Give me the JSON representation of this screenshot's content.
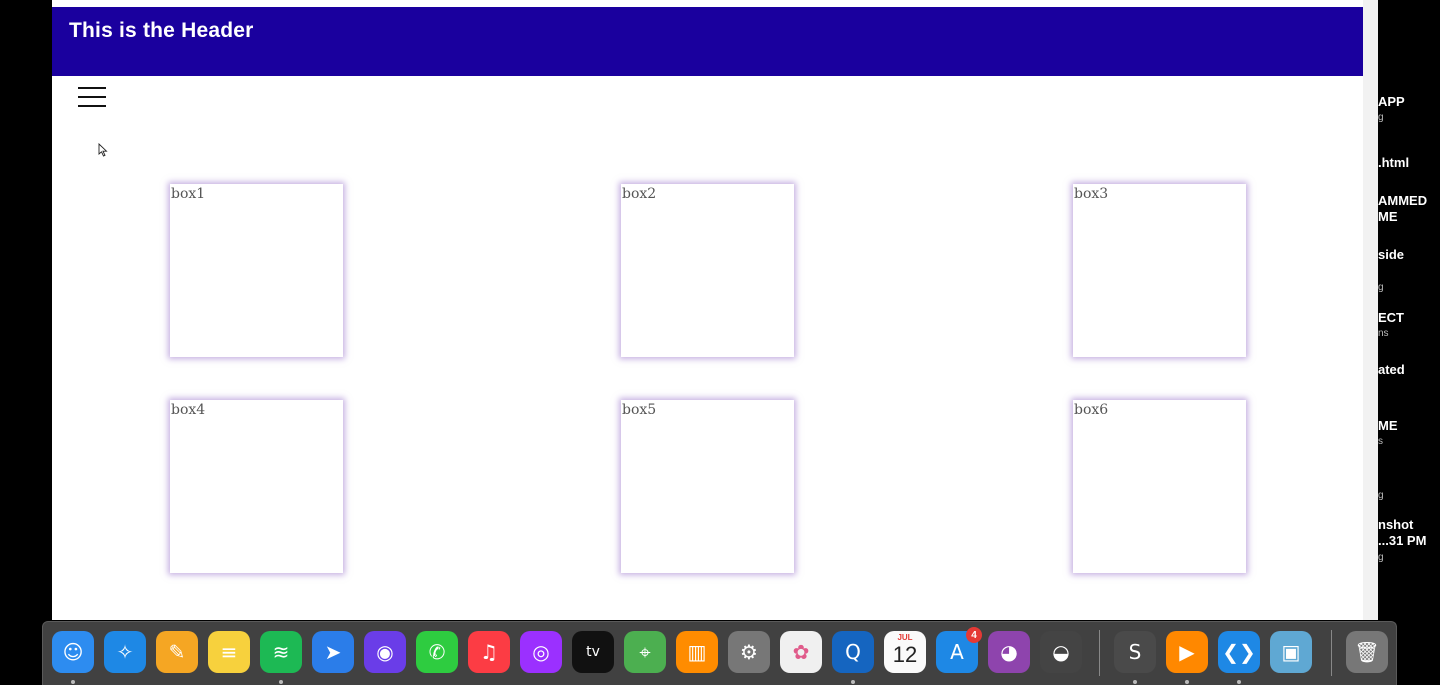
{
  "header": {
    "title": "This is the Header"
  },
  "boxes": [
    {
      "label": "box1"
    },
    {
      "label": "box2"
    },
    {
      "label": "box3"
    },
    {
      "label": "box4"
    },
    {
      "label": "box5"
    },
    {
      "label": "box6"
    }
  ],
  "right_panel": {
    "items": [
      {
        "text": "APP",
        "sub": "g"
      },
      {
        "text": ".html",
        "sub": ""
      },
      {
        "text": "AMMED",
        "sub": "ME"
      },
      {
        "text": "side",
        "sub": ""
      },
      {
        "text": "",
        "sub": "g"
      },
      {
        "text": "ECT",
        "sub": "ns"
      },
      {
        "text": "ated",
        "sub": ""
      },
      {
        "text": "ME",
        "sub": "s"
      },
      {
        "text": "",
        "sub": "g"
      },
      {
        "text": "nshot",
        "sub": "...31 PM"
      },
      {
        "text": "",
        "sub": "g"
      }
    ]
  },
  "dock": {
    "calendar": {
      "month": "JUL",
      "day": "12"
    },
    "app_store_badge": "4",
    "apps": [
      {
        "name": "finder-icon",
        "glyph": "☺",
        "color": "#2d8cf0"
      },
      {
        "name": "safari-icon",
        "glyph": "✧",
        "color": "#1e88e5"
      },
      {
        "name": "pages-icon",
        "glyph": "✎",
        "color": "#f5a623"
      },
      {
        "name": "notes-icon",
        "glyph": "≡",
        "color": "#f7d13d"
      },
      {
        "name": "spotify-icon",
        "glyph": "≋",
        "color": "#1db954"
      },
      {
        "name": "spark-icon",
        "glyph": "➤",
        "color": "#2b7de9"
      },
      {
        "name": "siri-icon",
        "glyph": "◉",
        "color": "#6a3de8"
      },
      {
        "name": "facetime-icon",
        "glyph": "✆",
        "color": "#2ecc40"
      },
      {
        "name": "music-icon",
        "glyph": "♫",
        "color": "#fc3c44"
      },
      {
        "name": "podcasts-icon",
        "glyph": "◎",
        "color": "#9b30ff"
      },
      {
        "name": "apple-tv-icon",
        "glyph": "tv",
        "color": "#111"
      },
      {
        "name": "maps-icon",
        "glyph": "⌖",
        "color": "#4caf50"
      },
      {
        "name": "books-icon",
        "glyph": "▥",
        "color": "#ff8c00"
      },
      {
        "name": "system-preferences-icon",
        "glyph": "⚙",
        "color": "#777"
      },
      {
        "name": "photos-icon",
        "glyph": "✿",
        "color": "#f0f0f0"
      },
      {
        "name": "quicktime-icon",
        "glyph": "Q",
        "color": "#1565c0"
      },
      {
        "name": "calendar-icon",
        "glyph": "",
        "color": "#fafafa"
      },
      {
        "name": "app-store-icon",
        "glyph": "A",
        "color": "#1e88e5"
      },
      {
        "name": "github-desktop-icon",
        "glyph": "◕",
        "color": "#8e44ad"
      },
      {
        "name": "sunglasses-icon",
        "glyph": "◒",
        "color": "#444"
      },
      {
        "name": "sublime-text-icon",
        "glyph": "S",
        "color": "#4a4a4a"
      },
      {
        "name": "vlc-icon",
        "glyph": "▶",
        "color": "#ff8800"
      },
      {
        "name": "vscode-icon",
        "glyph": "❮❯",
        "color": "#1e88e5"
      },
      {
        "name": "preview-icon",
        "glyph": "▣",
        "color": "#5fa8d3"
      },
      {
        "name": "trash-icon",
        "glyph": "🗑",
        "color": "#777"
      }
    ]
  }
}
